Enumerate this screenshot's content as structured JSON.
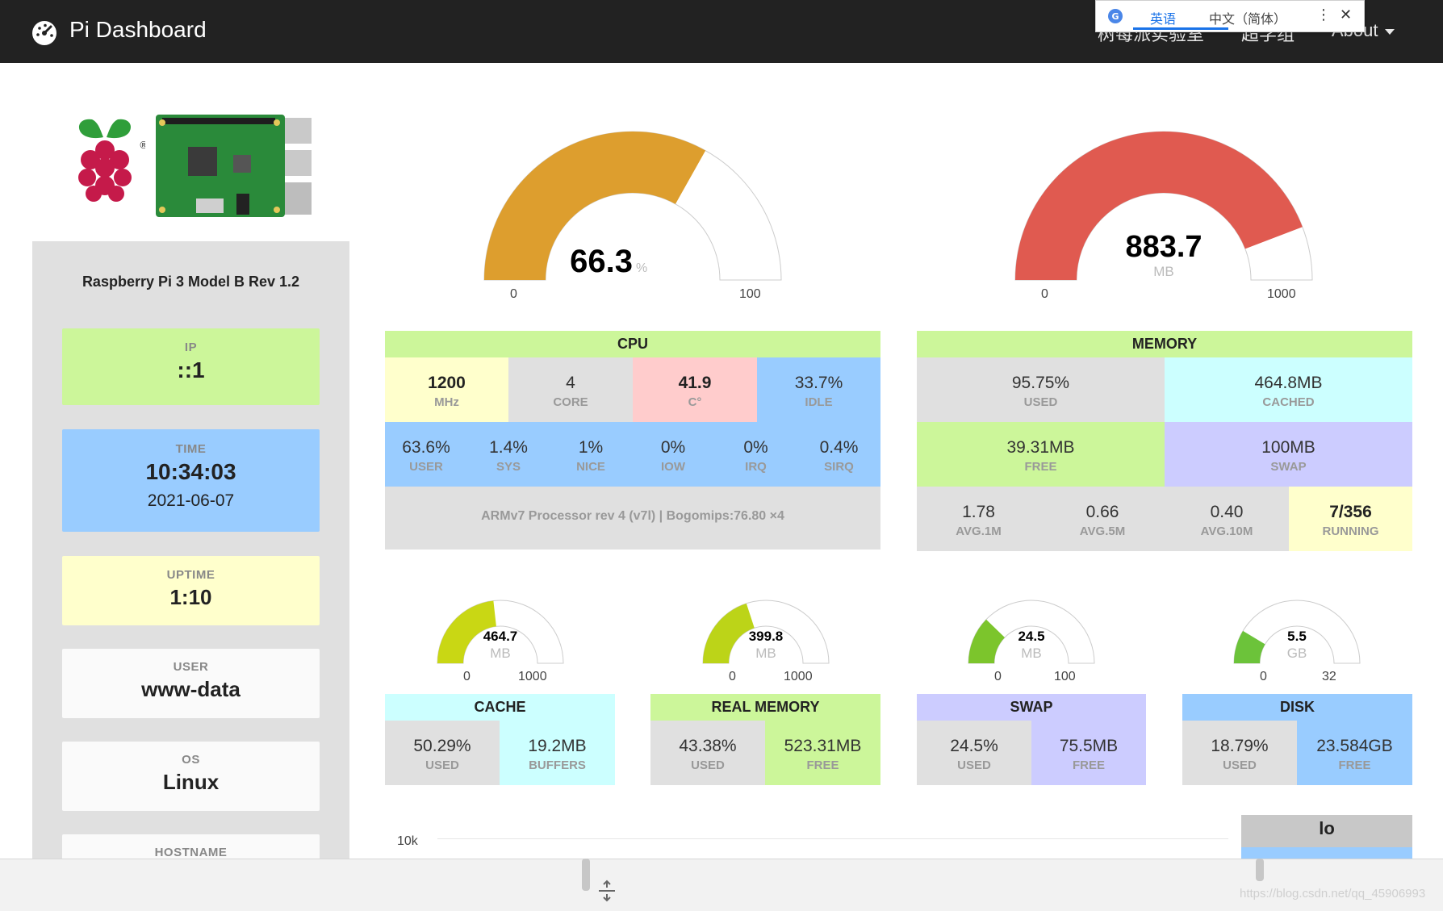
{
  "nav": {
    "title": "Pi Dashboard",
    "link1": "树莓派实验室",
    "link2": "超学组",
    "about": "About"
  },
  "translate_bar": {
    "lang_active": "英语",
    "lang_other": "中文（简体）",
    "menu_glyph": "⋮",
    "close_glyph": "✕"
  },
  "device": {
    "model": "Raspberry Pi 3 Model B Rev 1.2",
    "ip_label": "IP",
    "ip": "::1",
    "time_label": "TIME",
    "time": "10:34:03",
    "date": "2021-06-07",
    "uptime_label": "UPTIME",
    "uptime": "1:10",
    "user_label": "USER",
    "user": "www-data",
    "os_label": "OS",
    "os": "Linux",
    "hostname_label": "HOSTNAME"
  },
  "big_gauges": {
    "cpu": {
      "value": "66.3",
      "unit": "%",
      "min": "0",
      "max": "100",
      "fraction": 0.663,
      "color": "#DD9E2E"
    },
    "mem": {
      "value": "883.7",
      "unit": "MB",
      "min": "0",
      "max": "1000",
      "fraction": 0.8837,
      "color": "#E05A50"
    }
  },
  "cpu": {
    "title": "CPU",
    "mhz": "1200",
    "mhz_unit": "MHz",
    "cores": "4",
    "cores_label": "CORE",
    "temp": "41.9",
    "temp_unit": "C°",
    "idle": "33.7%",
    "idle_label": "IDLE",
    "user": "63.6%",
    "user_label": "USER",
    "sys": "1.4%",
    "sys_label": "SYS",
    "nice": "1%",
    "nice_label": "NICE",
    "iow": "0%",
    "iow_label": "IOW",
    "irq": "0%",
    "irq_label": "IRQ",
    "sirq": "0.4%",
    "sirq_label": "SIRQ",
    "processor": "ARMv7 Processor rev 4 (v7l) | Bogomips:76.80 ×4"
  },
  "memory": {
    "title": "MEMORY",
    "used": "95.75%",
    "used_label": "USED",
    "cached": "464.8MB",
    "cached_label": "CACHED",
    "free": "39.31MB",
    "free_label": "FREE",
    "swap": "100MB",
    "swap_label": "SWAP",
    "avg1": "1.78",
    "avg1_label": "AVG.1M",
    "avg5": "0.66",
    "avg5_label": "AVG.5M",
    "avg10": "0.40",
    "avg10_label": "AVG.10M",
    "running": "7/356",
    "running_label": "RUNNING"
  },
  "small_gauges": {
    "cache": {
      "value": "464.7",
      "unit": "MB",
      "min": "0",
      "max": "1000",
      "fraction": 0.4647,
      "color": "#C9D714"
    },
    "real": {
      "value": "399.8",
      "unit": "MB",
      "min": "0",
      "max": "1000",
      "fraction": 0.3998,
      "color": "#BCD418"
    },
    "swap": {
      "value": "24.5",
      "unit": "MB",
      "min": "0",
      "max": "100",
      "fraction": 0.245,
      "color": "#7CC52C"
    },
    "disk": {
      "value": "5.5",
      "unit": "GB",
      "min": "0",
      "max": "32",
      "fraction": 0.1719,
      "color": "#6CC33A"
    }
  },
  "panels": {
    "cache": {
      "title": "CACHE",
      "used": "50.29%",
      "used_label": "USED",
      "buffers": "19.2MB",
      "buffers_label": "BUFFERS"
    },
    "real": {
      "title": "REAL MEMORY",
      "used": "43.38%",
      "used_label": "USED",
      "free": "523.31MB",
      "free_label": "FREE"
    },
    "swap": {
      "title": "SWAP",
      "used": "24.5%",
      "used_label": "USED",
      "free": "75.5MB",
      "free_label": "FREE"
    },
    "disk": {
      "title": "DISK",
      "used": "18.79%",
      "used_label": "USED",
      "free": "23.584GB",
      "free_label": "FREE"
    }
  },
  "chart": {
    "axis_top": "10k",
    "lo_label": "lo"
  },
  "watermark": "https://blog.csdn.net/qq_45906993",
  "colors": {
    "green": "#CCF69A",
    "blue": "#99CCFF",
    "yellow": "#FFFFCC",
    "pink": "#FFCCCC",
    "cyan": "#CCFFFF",
    "lavender": "#CCCCFF",
    "grey": "#E0E0E0",
    "white": "#FAFAFA"
  }
}
